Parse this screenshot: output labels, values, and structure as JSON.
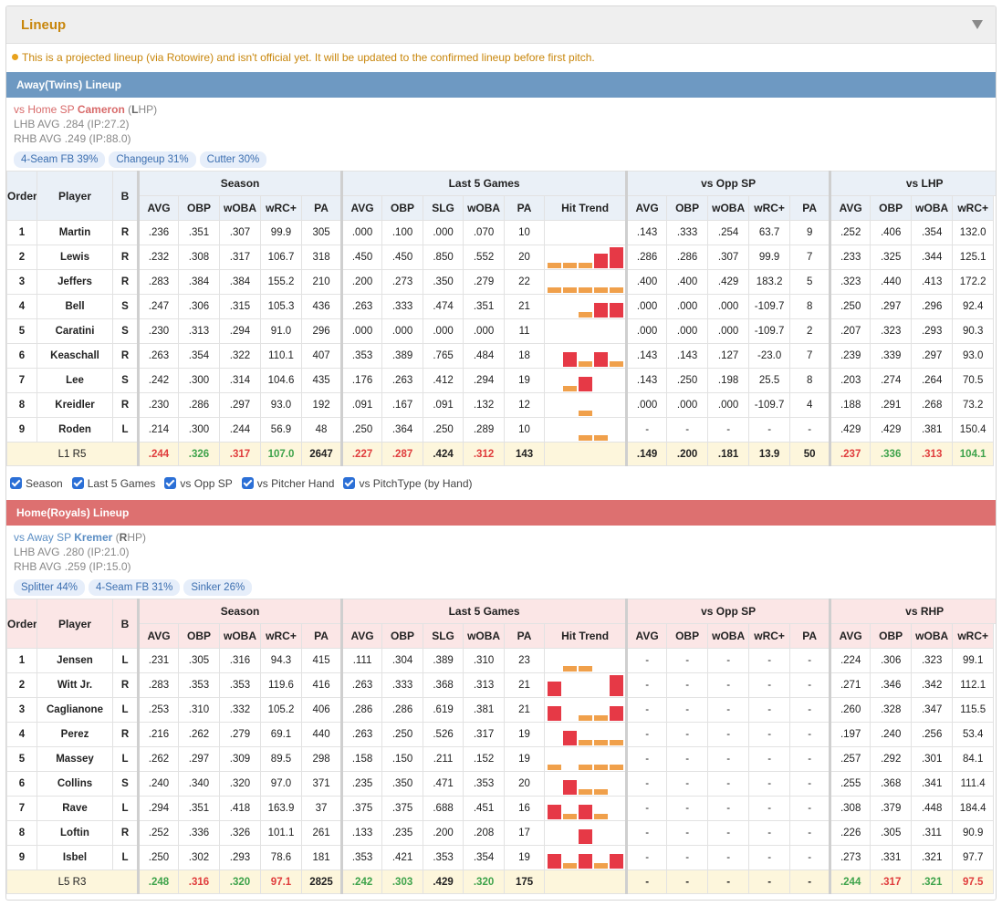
{
  "panel": {
    "title": "Lineup",
    "notice": "This is a projected lineup (via Rotowire) and isn't official yet. It will be updated to the confirmed lineup before first pitch."
  },
  "colors": {
    "accent": "#c8860b",
    "away_bar": "#6e99c2",
    "home_bar": "#dd7070",
    "good": "#3ea34b",
    "bad": "#e03c3c",
    "trend_hit": "#e63946",
    "trend_nohit": "#f0a04b"
  },
  "headers": {
    "order": "Order",
    "player": "Player",
    "hand": "B",
    "season": "Season",
    "last5": "Last 5 Games",
    "vs_opp_sp": "vs Opp SP",
    "avg": "AVG",
    "obp": "OBP",
    "woba": "wOBA",
    "wrc": "wRC+",
    "pa": "PA",
    "slg": "SLG",
    "hit_trend": "Hit Trend"
  },
  "filters": [
    "Season",
    "Last 5 Games",
    "vs Opp SP",
    "vs Pitcher Hand",
    "vs PitchType (by Hand)"
  ],
  "away": {
    "bar": "Away(Twins) Lineup",
    "sp_prefix": "vs Home SP ",
    "sp_name": "Cameron",
    "sp_open": " (",
    "sp_hand_letter": "L",
    "sp_close": "HP)",
    "lhb": "LHB AVG .284 (IP:27.2)",
    "rhb": "RHB AVG .249 (IP:88.0)",
    "pitches": [
      "4-Seam FB 39%",
      "Changeup 31%",
      "Cutter 30%"
    ],
    "vs_hand": "vs LHP",
    "rows": [
      {
        "order": "1",
        "name": "Martin",
        "hand": "R",
        "s": [
          ".236",
          ".351",
          ".307",
          "99.9",
          "305"
        ],
        "l": [
          ".000",
          ".100",
          ".000",
          ".070",
          "10"
        ],
        "trend": [],
        "o": [
          ".143",
          ".333",
          ".254",
          "63.7",
          "9"
        ],
        "h": [
          ".252",
          ".406",
          ".354",
          "132.0"
        ]
      },
      {
        "order": "2",
        "name": "Lewis",
        "hand": "R",
        "s": [
          ".232",
          ".308",
          ".317",
          "106.7",
          "318"
        ],
        "l": [
          ".450",
          ".450",
          ".850",
          ".552",
          "20"
        ],
        "trend": [
          0,
          0,
          0,
          1,
          2
        ],
        "o": [
          ".286",
          ".286",
          ".307",
          "99.9",
          "7"
        ],
        "h": [
          ".233",
          ".325",
          ".344",
          "125.1"
        ]
      },
      {
        "order": "3",
        "name": "Jeffers",
        "hand": "R",
        "s": [
          ".283",
          ".384",
          ".384",
          "155.2",
          "210"
        ],
        "l": [
          ".200",
          ".273",
          ".350",
          ".279",
          "22"
        ],
        "trend": [
          0,
          0,
          0,
          0,
          0
        ],
        "o": [
          ".400",
          ".400",
          ".429",
          "183.2",
          "5"
        ],
        "h": [
          ".323",
          ".440",
          ".413",
          "172.2"
        ]
      },
      {
        "order": "4",
        "name": "Bell",
        "hand": "S",
        "s": [
          ".247",
          ".306",
          ".315",
          "105.3",
          "436"
        ],
        "l": [
          ".263",
          ".333",
          ".474",
          ".351",
          "21"
        ],
        "trend": [
          -1,
          -1,
          0,
          1,
          1
        ],
        "o": [
          ".000",
          ".000",
          ".000",
          "-109.7",
          "8"
        ],
        "h": [
          ".250",
          ".297",
          ".296",
          "92.4"
        ]
      },
      {
        "order": "5",
        "name": "Caratini",
        "hand": "S",
        "s": [
          ".230",
          ".313",
          ".294",
          "91.0",
          "296"
        ],
        "l": [
          ".000",
          ".000",
          ".000",
          ".000",
          "11"
        ],
        "trend": [],
        "o": [
          ".000",
          ".000",
          ".000",
          "-109.7",
          "2"
        ],
        "h": [
          ".207",
          ".323",
          ".293",
          "90.3"
        ]
      },
      {
        "order": "6",
        "name": "Keaschall",
        "hand": "R",
        "s": [
          ".263",
          ".354",
          ".322",
          "110.1",
          "407"
        ],
        "l": [
          ".353",
          ".389",
          ".765",
          ".484",
          "18"
        ],
        "trend": [
          -1,
          1,
          0,
          1,
          0
        ],
        "o": [
          ".143",
          ".143",
          ".127",
          "-23.0",
          "7"
        ],
        "h": [
          ".239",
          ".339",
          ".297",
          "93.0"
        ]
      },
      {
        "order": "7",
        "name": "Lee",
        "hand": "S",
        "s": [
          ".242",
          ".300",
          ".314",
          "104.6",
          "435"
        ],
        "l": [
          ".176",
          ".263",
          ".412",
          ".294",
          "19"
        ],
        "trend": [
          -1,
          0,
          1,
          -1,
          -1
        ],
        "o": [
          ".143",
          ".250",
          ".198",
          "25.5",
          "8"
        ],
        "h": [
          ".203",
          ".274",
          ".264",
          "70.5"
        ]
      },
      {
        "order": "8",
        "name": "Kreidler",
        "hand": "R",
        "s": [
          ".230",
          ".286",
          ".297",
          "93.0",
          "192"
        ],
        "l": [
          ".091",
          ".167",
          ".091",
          ".132",
          "12"
        ],
        "trend": [
          -1,
          -1,
          0,
          -1,
          -1
        ],
        "o": [
          ".000",
          ".000",
          ".000",
          "-109.7",
          "4"
        ],
        "h": [
          ".188",
          ".291",
          ".268",
          "73.2"
        ]
      },
      {
        "order": "9",
        "name": "Roden",
        "hand": "L",
        "s": [
          ".214",
          ".300",
          ".244",
          "56.9",
          "48"
        ],
        "l": [
          ".250",
          ".364",
          ".250",
          ".289",
          "10"
        ],
        "trend": [
          -1,
          -1,
          0,
          0,
          -1
        ],
        "o": [
          "-",
          "-",
          "-",
          "-",
          "-"
        ],
        "h": [
          ".429",
          ".429",
          ".381",
          "150.4"
        ]
      }
    ],
    "summary": {
      "label_l": "L1",
      "label_r": "R5",
      "s": [
        {
          "v": ".244",
          "c": "r"
        },
        {
          "v": ".326",
          "c": "g"
        },
        {
          "v": ".317",
          "c": "r"
        },
        {
          "v": "107.0",
          "c": "g"
        },
        {
          "v": "2647",
          "c": "k"
        }
      ],
      "l": [
        {
          "v": ".227",
          "c": "r"
        },
        {
          "v": ".287",
          "c": "r"
        },
        {
          "v": ".424",
          "c": "k"
        },
        {
          "v": ".312",
          "c": "r"
        },
        {
          "v": "143",
          "c": "k"
        }
      ],
      "o": [
        {
          "v": ".149",
          "c": "k"
        },
        {
          "v": ".200",
          "c": "k"
        },
        {
          "v": ".181",
          "c": "k"
        },
        {
          "v": "13.9",
          "c": "k"
        },
        {
          "v": "50",
          "c": "k"
        }
      ],
      "h": [
        {
          "v": ".237",
          "c": "r"
        },
        {
          "v": ".336",
          "c": "g"
        },
        {
          "v": ".313",
          "c": "r"
        },
        {
          "v": "104.1",
          "c": "g"
        }
      ]
    }
  },
  "home": {
    "bar": "Home(Royals) Lineup",
    "sp_prefix": "vs Away SP ",
    "sp_name": "Kremer",
    "sp_open": " (",
    "sp_hand_letter": "R",
    "sp_close": "HP)",
    "lhb": "LHB AVG .280 (IP:21.0)",
    "rhb": "RHB AVG .259 (IP:15.0)",
    "pitches": [
      "Splitter 44%",
      "4-Seam FB 31%",
      "Sinker 26%"
    ],
    "vs_hand": "vs RHP",
    "rows": [
      {
        "order": "1",
        "name": "Jensen",
        "hand": "L",
        "s": [
          ".231",
          ".305",
          ".316",
          "94.3",
          "415"
        ],
        "l": [
          ".111",
          ".304",
          ".389",
          ".310",
          "23"
        ],
        "trend": [
          -1,
          0,
          0,
          -1,
          -1
        ],
        "o": [
          "-",
          "-",
          "-",
          "-",
          "-"
        ],
        "h": [
          ".224",
          ".306",
          ".323",
          "99.1"
        ]
      },
      {
        "order": "2",
        "name": "Witt Jr.",
        "hand": "R",
        "s": [
          ".283",
          ".353",
          ".353",
          "119.6",
          "416"
        ],
        "l": [
          ".263",
          ".333",
          ".368",
          ".313",
          "21"
        ],
        "trend": [
          1,
          -1,
          -1,
          -1,
          2
        ],
        "o": [
          "-",
          "-",
          "-",
          "-",
          "-"
        ],
        "h": [
          ".271",
          ".346",
          ".342",
          "112.1"
        ]
      },
      {
        "order": "3",
        "name": "Caglianone",
        "hand": "L",
        "s": [
          ".253",
          ".310",
          ".332",
          "105.2",
          "406"
        ],
        "l": [
          ".286",
          ".286",
          ".619",
          ".381",
          "21"
        ],
        "trend": [
          1,
          -1,
          0,
          0,
          1
        ],
        "o": [
          "-",
          "-",
          "-",
          "-",
          "-"
        ],
        "h": [
          ".260",
          ".328",
          ".347",
          "115.5"
        ]
      },
      {
        "order": "4",
        "name": "Perez",
        "hand": "R",
        "s": [
          ".216",
          ".262",
          ".279",
          "69.1",
          "440"
        ],
        "l": [
          ".263",
          ".250",
          ".526",
          ".317",
          "19"
        ],
        "trend": [
          -1,
          1,
          0,
          0,
          0
        ],
        "o": [
          "-",
          "-",
          "-",
          "-",
          "-"
        ],
        "h": [
          ".197",
          ".240",
          ".256",
          "53.4"
        ]
      },
      {
        "order": "5",
        "name": "Massey",
        "hand": "L",
        "s": [
          ".262",
          ".297",
          ".309",
          "89.5",
          "298"
        ],
        "l": [
          ".158",
          ".150",
          ".211",
          ".152",
          "19"
        ],
        "trend": [
          0,
          -1,
          0,
          0,
          0
        ],
        "o": [
          "-",
          "-",
          "-",
          "-",
          "-"
        ],
        "h": [
          ".257",
          ".292",
          ".301",
          "84.1"
        ]
      },
      {
        "order": "6",
        "name": "Collins",
        "hand": "S",
        "s": [
          ".240",
          ".340",
          ".320",
          "97.0",
          "371"
        ],
        "l": [
          ".235",
          ".350",
          ".471",
          ".353",
          "20"
        ],
        "trend": [
          -1,
          1,
          0,
          0,
          -1
        ],
        "o": [
          "-",
          "-",
          "-",
          "-",
          "-"
        ],
        "h": [
          ".255",
          ".368",
          ".341",
          "111.4"
        ]
      },
      {
        "order": "7",
        "name": "Rave",
        "hand": "L",
        "s": [
          ".294",
          ".351",
          ".418",
          "163.9",
          "37"
        ],
        "l": [
          ".375",
          ".375",
          ".688",
          ".451",
          "16"
        ],
        "trend": [
          1,
          0,
          1,
          0,
          -1
        ],
        "o": [
          "-",
          "-",
          "-",
          "-",
          "-"
        ],
        "h": [
          ".308",
          ".379",
          ".448",
          "184.4"
        ]
      },
      {
        "order": "8",
        "name": "Loftin",
        "hand": "R",
        "s": [
          ".252",
          ".336",
          ".326",
          "101.1",
          "261"
        ],
        "l": [
          ".133",
          ".235",
          ".200",
          ".208",
          "17"
        ],
        "trend": [
          -1,
          -1,
          1,
          -1,
          -1
        ],
        "o": [
          "-",
          "-",
          "-",
          "-",
          "-"
        ],
        "h": [
          ".226",
          ".305",
          ".311",
          "90.9"
        ]
      },
      {
        "order": "9",
        "name": "Isbel",
        "hand": "L",
        "s": [
          ".250",
          ".302",
          ".293",
          "78.6",
          "181"
        ],
        "l": [
          ".353",
          ".421",
          ".353",
          ".354",
          "19"
        ],
        "trend": [
          1,
          0,
          1,
          0,
          1
        ],
        "o": [
          "-",
          "-",
          "-",
          "-",
          "-"
        ],
        "h": [
          ".273",
          ".331",
          ".321",
          "97.7"
        ]
      }
    ],
    "summary": {
      "label_l": "L5",
      "label_r": "R3",
      "s": [
        {
          "v": ".248",
          "c": "g"
        },
        {
          "v": ".316",
          "c": "r"
        },
        {
          "v": ".320",
          "c": "g"
        },
        {
          "v": "97.1",
          "c": "r"
        },
        {
          "v": "2825",
          "c": "k"
        }
      ],
      "l": [
        {
          "v": ".242",
          "c": "g"
        },
        {
          "v": ".303",
          "c": "g"
        },
        {
          "v": ".429",
          "c": "k"
        },
        {
          "v": ".320",
          "c": "g"
        },
        {
          "v": "175",
          "c": "k"
        }
      ],
      "o": [
        {
          "v": "-",
          "c": "k"
        },
        {
          "v": "-",
          "c": "k"
        },
        {
          "v": "-",
          "c": "k"
        },
        {
          "v": "-",
          "c": "k"
        },
        {
          "v": "-",
          "c": "k"
        }
      ],
      "h": [
        {
          "v": ".244",
          "c": "g"
        },
        {
          "v": ".317",
          "c": "r"
        },
        {
          "v": ".321",
          "c": "g"
        },
        {
          "v": "97.5",
          "c": "r"
        }
      ]
    }
  }
}
